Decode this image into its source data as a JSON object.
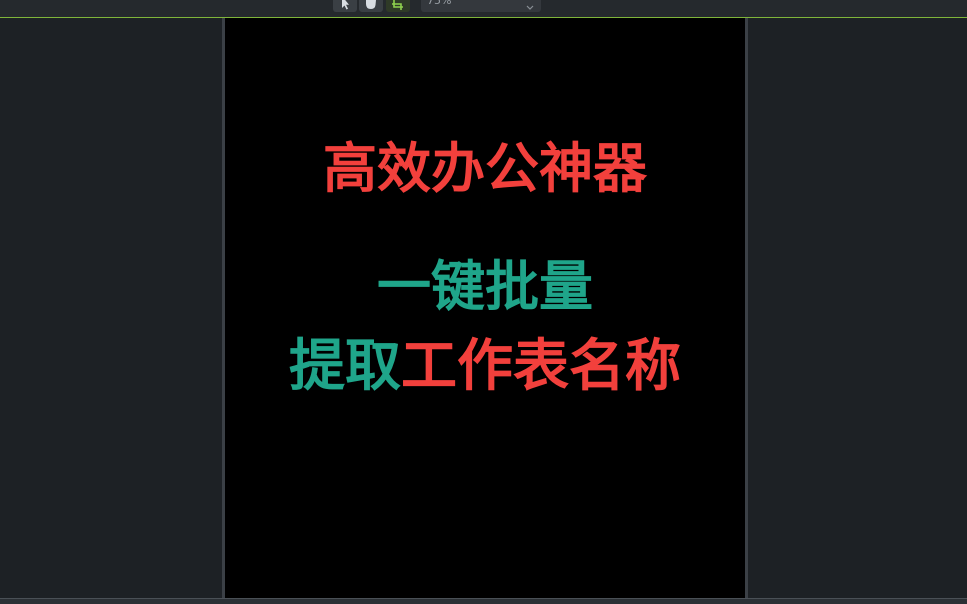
{
  "toolbar": {
    "tools": [
      {
        "name": "select-tool",
        "icon": "cursor-icon"
      },
      {
        "name": "hand-tool",
        "icon": "hand-icon"
      },
      {
        "name": "crop-tool",
        "icon": "crop-icon"
      }
    ],
    "zoom_value": "75%",
    "accent_color": "#7fb53a"
  },
  "canvas": {
    "title": "高效办公神器",
    "subtitle_line1": "一键批量",
    "subtitle_line2_part1": "提取",
    "subtitle_line2_part2": "工作表名称",
    "colors": {
      "red": "#f2403c",
      "teal": "#1fa58a",
      "background": "#000000"
    }
  }
}
